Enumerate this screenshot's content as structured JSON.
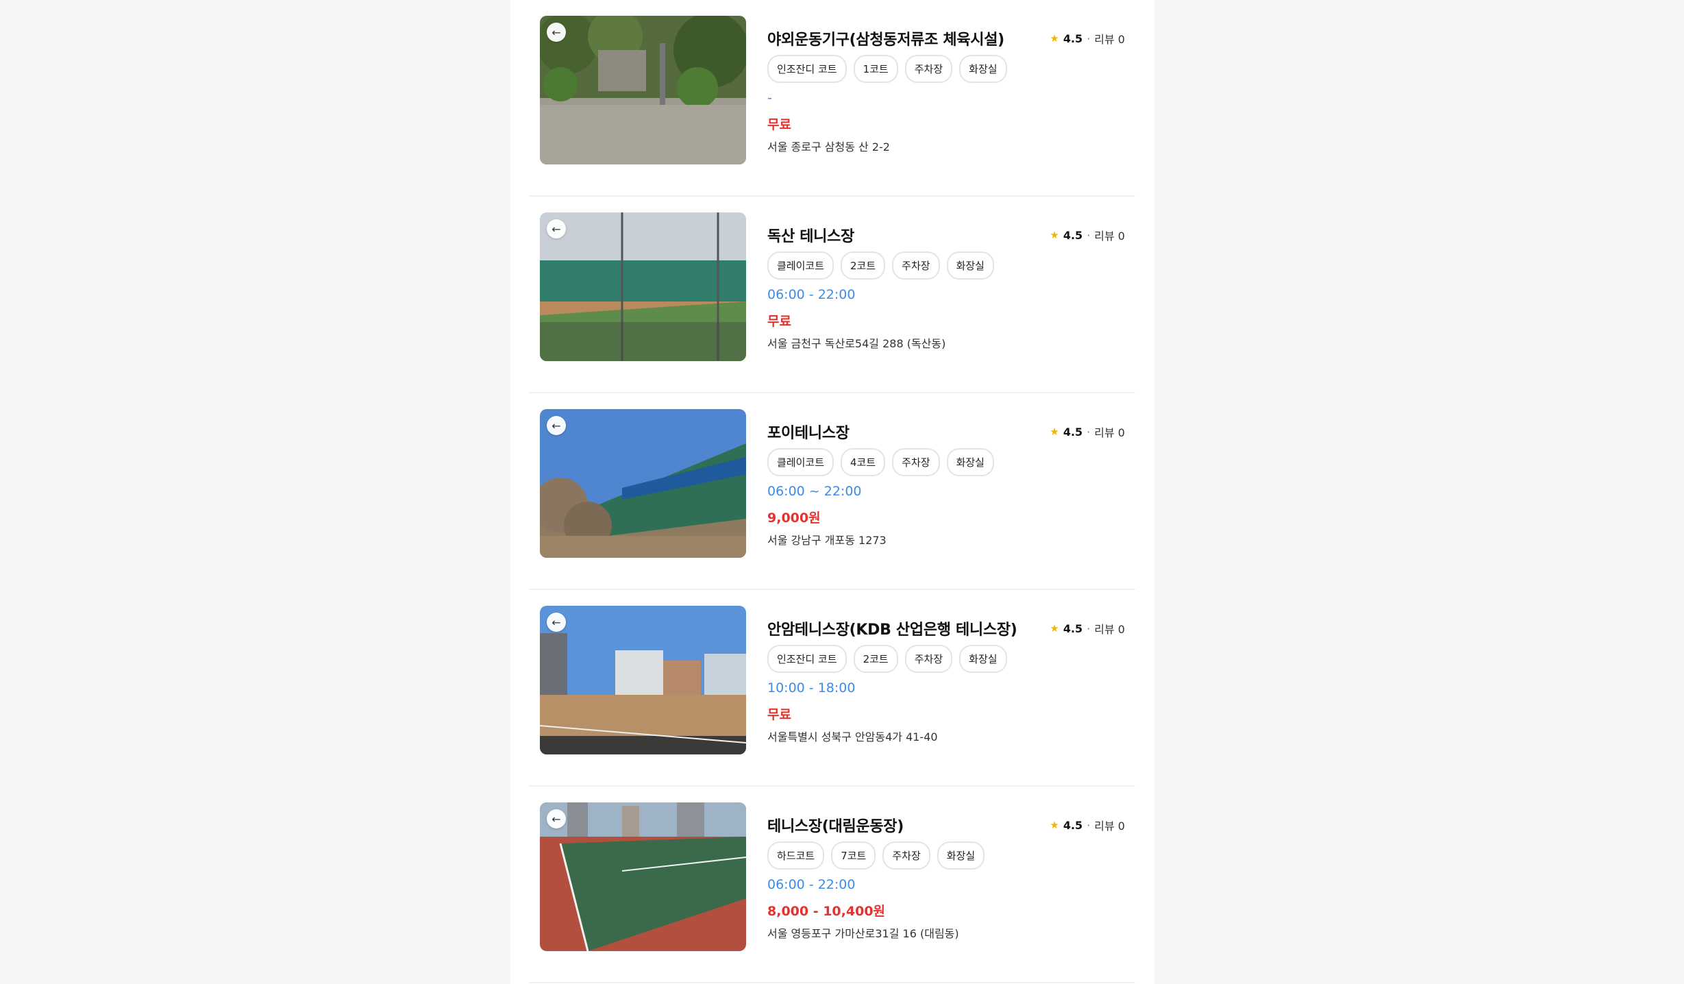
{
  "courts": [
    {
      "title": "야외운동기구(삼청동저류조 체육시설)",
      "rating": "4.5",
      "separator": "·",
      "review": "리뷰 0",
      "tags": [
        "인조잔디 코트",
        "1코트",
        "주차장",
        "화장실"
      ],
      "hours": "-",
      "price": "무료",
      "address": "서울 종로구 삼청동 산 2-2"
    },
    {
      "title": "독산 테니스장",
      "rating": "4.5",
      "separator": "·",
      "review": "리뷰 0",
      "tags": [
        "클레이코트",
        "2코트",
        "주차장",
        "화장실"
      ],
      "hours": "06:00 - 22:00",
      "price": "무료",
      "address": "서울 금천구 독산로54길 288 (독산동)"
    },
    {
      "title": "포이테니스장",
      "rating": "4.5",
      "separator": "·",
      "review": "리뷰 0",
      "tags": [
        "클레이코트",
        "4코트",
        "주차장",
        "화장실"
      ],
      "hours": "06:00 ~ 22:00",
      "price": "9,000원",
      "address": "서울 강남구 개포동 1273"
    },
    {
      "title": "안암테니스장(KDB 산업은행 테니스장)",
      "rating": "4.5",
      "separator": "·",
      "review": "리뷰 0",
      "tags": [
        "인조잔디 코트",
        "2코트",
        "주차장",
        "화장실"
      ],
      "hours": "10:00 - 18:00",
      "price": "무료",
      "address": "서울특별시 성북구 안암동4가 41-40"
    },
    {
      "title": "테니스장(대림운동장)",
      "rating": "4.5",
      "separator": "·",
      "review": "리뷰 0",
      "tags": [
        "하드코트",
        "7코트",
        "주차장",
        "화장실"
      ],
      "hours": "06:00 - 22:00",
      "price": "8,000 - 10,400원",
      "address": "서울 영등포구 가마산로31길 16 (대림동)"
    }
  ],
  "icons": {
    "back": "←",
    "star": "★"
  },
  "colors": {
    "hours": "#3d8be8",
    "price": "#e5322d",
    "star": "#f5b400"
  }
}
